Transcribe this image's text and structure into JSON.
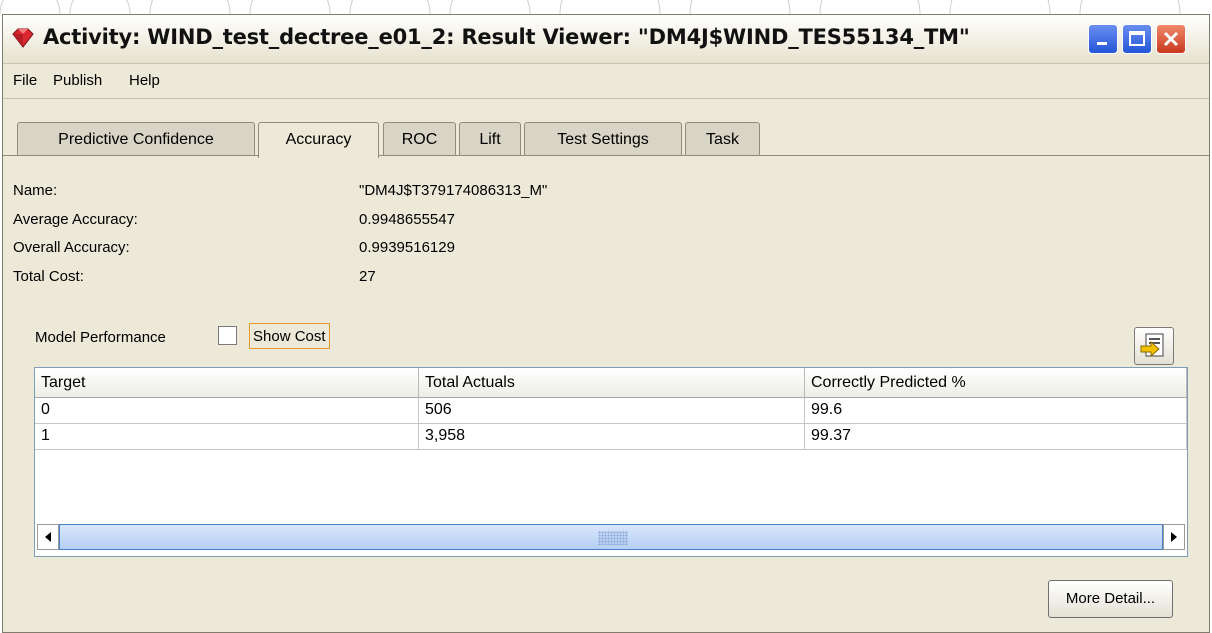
{
  "window": {
    "title": "Activity: WIND_test_dectree_e01_2: Result Viewer: \"DM4J$WIND_TES55134_TM\""
  },
  "menu": [
    {
      "label": "File"
    },
    {
      "label": "Publish"
    },
    {
      "label": "Help"
    }
  ],
  "tabs": [
    {
      "label": "Predictive Confidence"
    },
    {
      "label": "Accuracy"
    },
    {
      "label": "ROC"
    },
    {
      "label": "Lift"
    },
    {
      "label": "Test Settings"
    },
    {
      "label": "Task"
    }
  ],
  "active_tab": "Accuracy",
  "info": [
    {
      "label": "Name:",
      "value": "\"DM4J$T379174086313_M\""
    },
    {
      "label": "Average Accuracy:",
      "value": "0.9948655547"
    },
    {
      "label": "Overall Accuracy:",
      "value": "0.9939516129"
    },
    {
      "label": "Total Cost:",
      "value": "27"
    }
  ],
  "model_performance": {
    "label": "Model Performance",
    "show_cost_label": "Show Cost",
    "show_cost_checked": false
  },
  "table": {
    "columns": [
      "Target",
      "Total Actuals",
      "Correctly Predicted %"
    ],
    "rows": [
      [
        "0",
        "506",
        "99.6"
      ],
      [
        "1",
        "3,958",
        "99.37"
      ]
    ]
  },
  "buttons": {
    "more_detail": "More Detail..."
  },
  "icons": {
    "app": "ruby-gem-icon",
    "export": "export-icon",
    "minimize": "minimize-icon",
    "maximize": "maximize-icon",
    "close": "close-icon"
  },
  "colors": {
    "window_bg": "#ece9d8",
    "scroll_thumb": "#b6cff3",
    "focus_border": "#e79a2a"
  }
}
